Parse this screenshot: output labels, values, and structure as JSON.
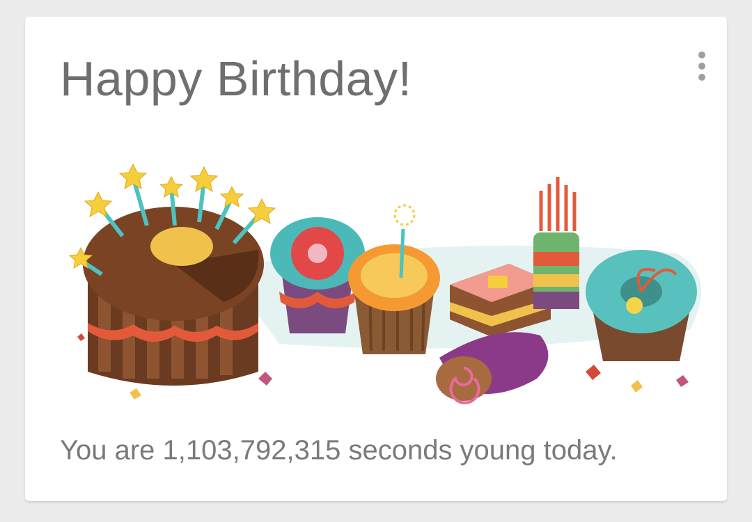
{
  "card": {
    "title": "Happy Birthday!",
    "subtitle": "You are 1,103,792,315 seconds young today.",
    "menu_icon": "overflow-menu-icon",
    "illustration": "birthday-cakes-illustration"
  },
  "colors": {
    "background": "#ececec",
    "card": "#ffffff",
    "title": "#6f6f6f",
    "subtitle": "#7a7a7a"
  }
}
